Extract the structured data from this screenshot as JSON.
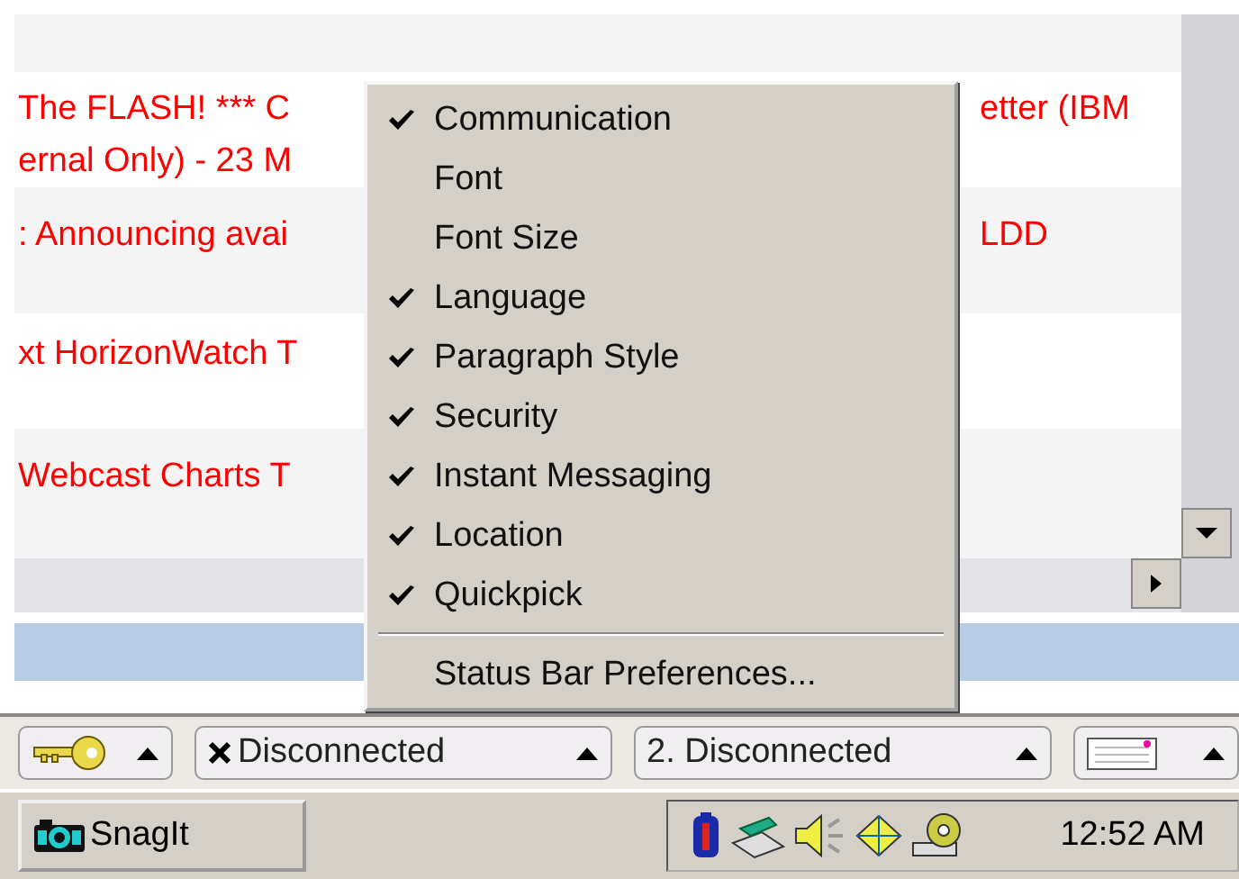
{
  "list": {
    "rows": [
      {
        "lines": [
          {
            "left": "The FLASH! *** C",
            "right": "etter (IBM"
          },
          {
            "left": "ernal Only) - 23 M"
          }
        ]
      },
      {
        "lines": [
          {
            "left": ": Announcing avai",
            "right": "LDD"
          }
        ]
      },
      {
        "lines": [
          {
            "left": "xt HorizonWatch T"
          }
        ]
      },
      {
        "lines": [
          {
            "left": "Webcast Charts T"
          }
        ]
      }
    ]
  },
  "context_menu": {
    "items": [
      {
        "kind": "item",
        "label": "Communication",
        "checked": true
      },
      {
        "kind": "item",
        "label": "Font",
        "checked": false
      },
      {
        "kind": "item",
        "label": "Font Size",
        "checked": false
      },
      {
        "kind": "item",
        "label": "Language",
        "checked": true
      },
      {
        "kind": "item",
        "label": "Paragraph Style",
        "checked": true
      },
      {
        "kind": "item",
        "label": "Security",
        "checked": true
      },
      {
        "kind": "item",
        "label": "Instant Messaging",
        "checked": true
      },
      {
        "kind": "item",
        "label": "Location",
        "checked": true
      },
      {
        "kind": "item",
        "label": "Quickpick",
        "checked": true
      },
      {
        "kind": "separator"
      },
      {
        "kind": "item",
        "label": "Status Bar Preferences...",
        "checked": false
      }
    ]
  },
  "status_bar": {
    "panels": [
      {
        "kind": "key"
      },
      {
        "kind": "status",
        "label": "Disconnected",
        "x_mark": true
      },
      {
        "kind": "status",
        "label": "2. Disconnected",
        "x_mark": false
      },
      {
        "kind": "keyboard"
      }
    ]
  },
  "taskbar": {
    "buttons": [
      {
        "label": "SnagIt"
      }
    ],
    "clock": "12:52 AM"
  }
}
